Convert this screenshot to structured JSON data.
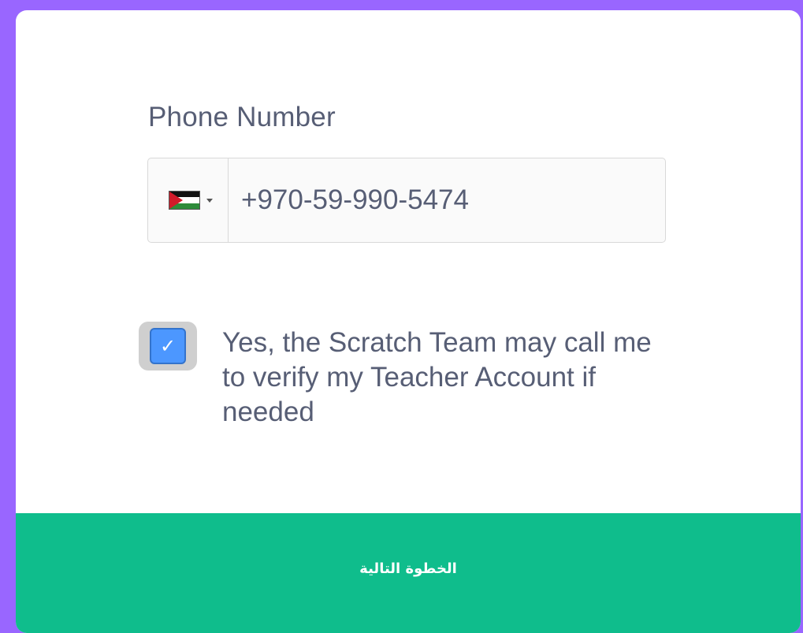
{
  "form": {
    "phone_label": "Phone Number",
    "country": {
      "flag_icon": "palestine-flag-icon",
      "caret_icon": "caret-down-icon"
    },
    "phone_value": "+970-59-990-5474",
    "consent": {
      "checked": true,
      "check_glyph": "✓",
      "label": "Yes, the Scratch Team may call me to verify my Teacher Account if needed"
    },
    "next_button_label": "الخطوة التالية"
  },
  "colors": {
    "frame_border": "#9966ff",
    "checkbox_blue": "#4c97ff",
    "button_green": "#0fbd8c",
    "text_gray": "#575e75"
  }
}
